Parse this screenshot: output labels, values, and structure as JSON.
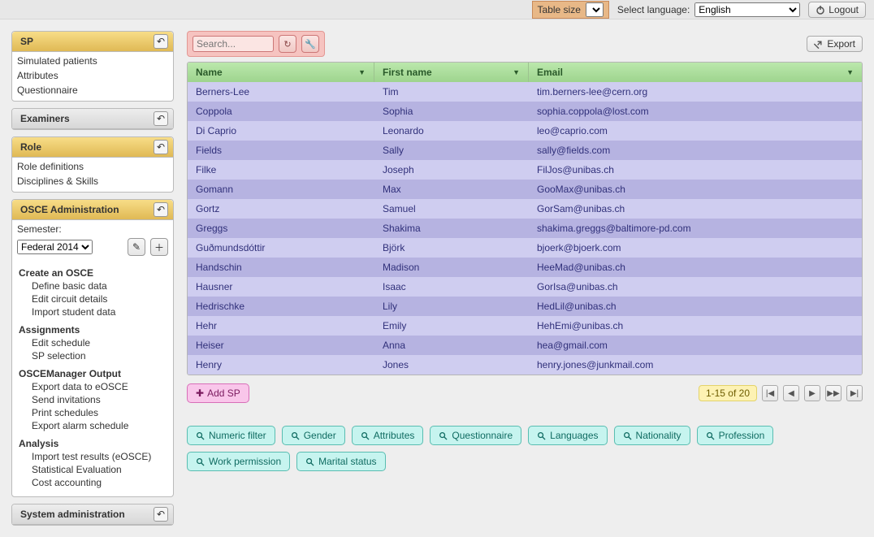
{
  "topbar": {
    "table_size_label": "Table size",
    "table_size_value": "",
    "lang_label": "Select language:",
    "lang_value": "English",
    "logout": "Logout"
  },
  "sidebar": {
    "sp": {
      "title": "SP",
      "items": [
        "Simulated patients",
        "Attributes",
        "Questionnaire"
      ]
    },
    "examiners": {
      "title": "Examiners"
    },
    "role": {
      "title": "Role",
      "items": [
        "Role definitions",
        "Disciplines & Skills"
      ]
    },
    "osce": {
      "title": "OSCE Administration",
      "semester_label": "Semester:",
      "semester_value": "Federal 2014",
      "sections": [
        {
          "heading": "Create an OSCE",
          "items": [
            "Define basic data",
            "Edit circuit details",
            "Import student data"
          ]
        },
        {
          "heading": "Assignments",
          "items": [
            "Edit schedule",
            "SP selection"
          ]
        },
        {
          "heading": "OSCEManager Output",
          "items": [
            "Export data to eOSCE",
            "Send invitations",
            "Print schedules",
            "Export alarm schedule"
          ]
        },
        {
          "heading": "Analysis",
          "items": [
            "Import test results (eOSCE)",
            "Statistical Evaluation",
            "Cost accounting"
          ]
        }
      ]
    },
    "sysadmin": {
      "title": "System administration"
    }
  },
  "toolbar": {
    "search_placeholder": "Search...",
    "export": "Export"
  },
  "table": {
    "headers": {
      "name": "Name",
      "first": "First name",
      "email": "Email"
    },
    "rows": [
      {
        "name": "Berners-Lee",
        "first": "Tim",
        "email": "tim.berners-lee@cern.org"
      },
      {
        "name": "Coppola",
        "first": "Sophia",
        "email": "sophia.coppola@lost.com"
      },
      {
        "name": "Di Caprio",
        "first": "Leonardo",
        "email": "leo@caprio.com"
      },
      {
        "name": "Fields",
        "first": "Sally",
        "email": "sally@fields.com"
      },
      {
        "name": "Filke",
        "first": "Joseph",
        "email": "FilJos@unibas.ch"
      },
      {
        "name": "Gomann",
        "first": "Max",
        "email": "GooMax@unibas.ch"
      },
      {
        "name": "Gortz",
        "first": "Samuel",
        "email": "GorSam@unibas.ch"
      },
      {
        "name": "Greggs",
        "first": "Shakima",
        "email": "shakima.greggs@baltimore-pd.com"
      },
      {
        "name": "Guðmundsdóttir",
        "first": "Björk",
        "email": "bjoerk@bjoerk.com"
      },
      {
        "name": "Handschin",
        "first": "Madison",
        "email": "HeeMad@unibas.ch"
      },
      {
        "name": "Hausner",
        "first": "Isaac",
        "email": "GorIsa@unibas.ch"
      },
      {
        "name": "Hedrischke",
        "first": "Lily",
        "email": "HedLil@unibas.ch"
      },
      {
        "name": "Hehr",
        "first": "Emily",
        "email": "HehEmi@unibas.ch"
      },
      {
        "name": "Heiser",
        "first": "Anna",
        "email": "hea@gmail.com"
      },
      {
        "name": "Henry",
        "first": "Jones",
        "email": "henry.jones@junkmail.com"
      }
    ]
  },
  "footer": {
    "add_sp": "Add SP",
    "pager_status": "1-15 of 20"
  },
  "filters": [
    "Numeric filter",
    "Gender",
    "Attributes",
    "Questionnaire",
    "Languages",
    "Nationality",
    "Profession",
    "Work permission",
    "Marital status"
  ]
}
